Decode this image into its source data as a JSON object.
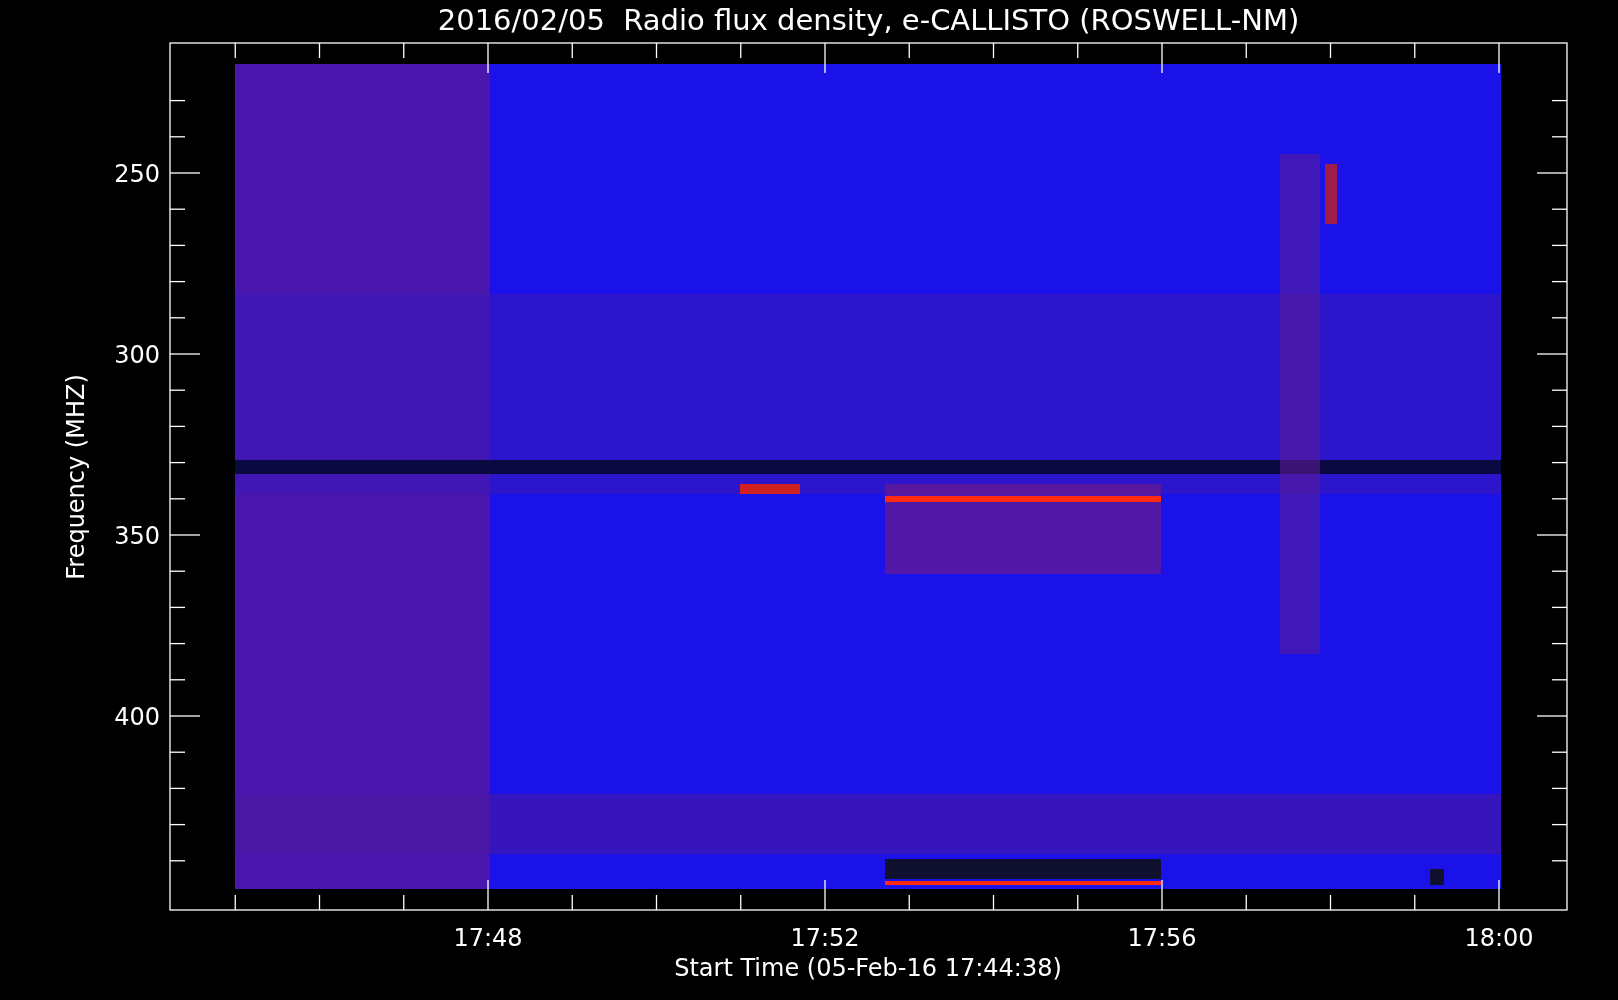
{
  "title": "2016/02/05  Radio flux density, e-CALLISTO (ROSWELL-NM)",
  "y_axis": {
    "label": "Frequency (MHZ)",
    "tick_labels": [
      "250",
      "300",
      "350",
      "400"
    ]
  },
  "x_axis": {
    "label": "Start Time (05-Feb-16 17:44:38)",
    "tick_labels": [
      "17:48",
      "17:52",
      "17:56",
      "18:00"
    ]
  }
}
